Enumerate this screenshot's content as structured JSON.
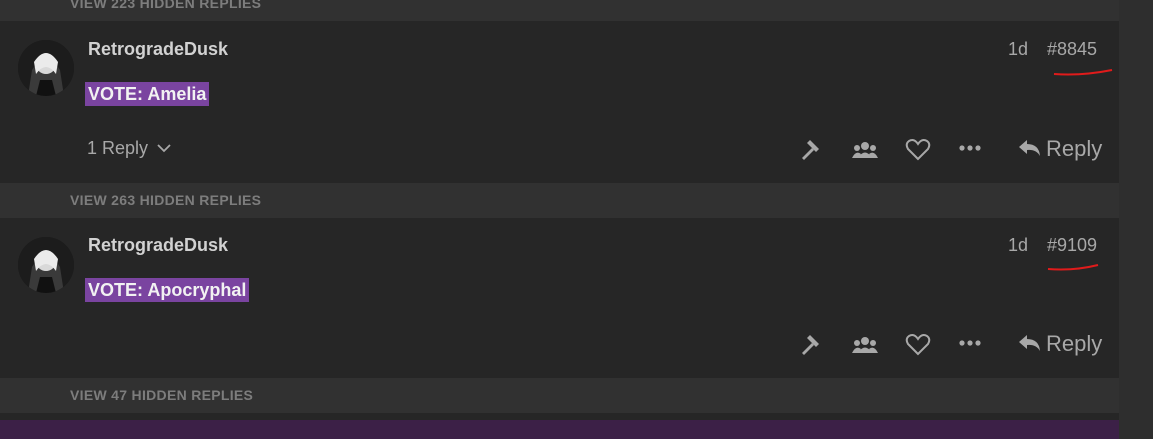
{
  "hidden_bars": [
    {
      "label": "VIEW 223 HIDDEN REPLIES"
    },
    {
      "label": "VIEW 263 HIDDEN REPLIES"
    },
    {
      "label": "VIEW 47 HIDDEN REPLIES"
    }
  ],
  "posts": [
    {
      "username": "RetrogradeDusk",
      "time": "1d",
      "number": "#8845",
      "vote": "VOTE: Amelia",
      "replies_label": "1 Reply",
      "reply_label": "Reply"
    },
    {
      "username": "RetrogradeDusk",
      "time": "1d",
      "number": "#9109",
      "vote": "VOTE: Apocryphal",
      "reply_label": "Reply"
    }
  ],
  "icons": [
    "gavel-icon",
    "group-icon",
    "heart-icon",
    "more-icon",
    "reply-arrow-icon",
    "chevron-down-icon"
  ],
  "colors": {
    "vote_bg": "#7a44a0",
    "annotation": "#e01b1b",
    "bottom_bar": "#3c2047"
  }
}
